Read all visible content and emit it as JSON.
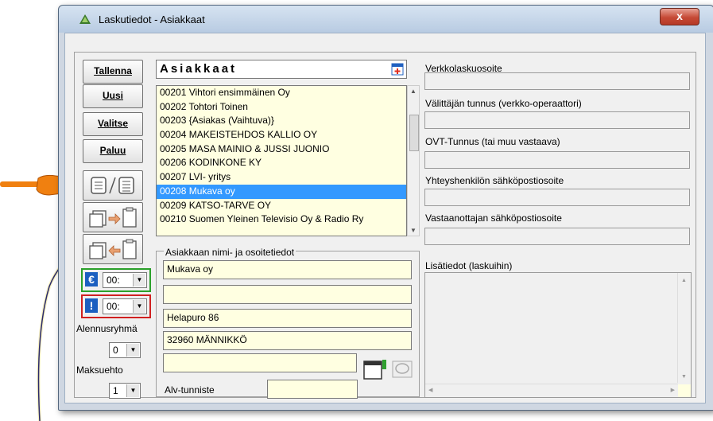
{
  "window": {
    "title": "Laskutiedot - Asiakkaat",
    "close_label": "x"
  },
  "buttons": {
    "save": "Tallenna",
    "new": "Uusi",
    "select": "Valitse",
    "back": "Paluu"
  },
  "customers": {
    "header": "Asiakkaat",
    "items": [
      "00201  Vihtori ensimmäinen Oy",
      "00202  Tohtori Toinen",
      "00203  {Asiakas (Vaihtuva)}",
      "00204  MAKEISTEHDOS KALLIO OY",
      "00205  MASA MAINIO & JUSSI JUONIO",
      "00206  KODINKONE KY",
      "00207  LVI- yritys",
      "00208  Mukava oy",
      "00209  KATSO-TARVE OY",
      "00210  Suomen Yleinen Televisio Oy & Radio Ry"
    ],
    "selected_index": 7
  },
  "currency": {
    "icon": "€",
    "value": "00:"
  },
  "priority": {
    "icon": "!",
    "value": "00:"
  },
  "discount_group": {
    "label": "Alennusryhmä",
    "value": "0"
  },
  "payment_term": {
    "label": "Maksuehto",
    "value": "1"
  },
  "address": {
    "group_label": "Asiakkaan nimi- ja osoitetiedot",
    "line1": "Mukava oy",
    "line2": "",
    "line3": "Helapuro 86",
    "line4": "32960 MÄNNIKKÖ",
    "line5": ""
  },
  "vat": {
    "label": "Alv-tunniste",
    "value": ""
  },
  "right_fields": {
    "e_invoice_address": "Verkkolaskuosoite",
    "intermediary_id": "Välittäjän tunnus (verkko-operaattori)",
    "ovt_id": "OVT-Tunnus (tai muu vastaava)",
    "contact_email": "Yhteyshenkilön sähköpostiosoite",
    "recipient_email": "Vastaanottajan sähköpostiosoite",
    "additional_info": "Lisätiedot (laskuihin)"
  },
  "colors": {
    "field_bg": "#ffffe1",
    "selection": "#3399ff",
    "currency_border": "#2aa02a",
    "priority_border": "#d02020",
    "pointer_hand": "#f08010"
  }
}
